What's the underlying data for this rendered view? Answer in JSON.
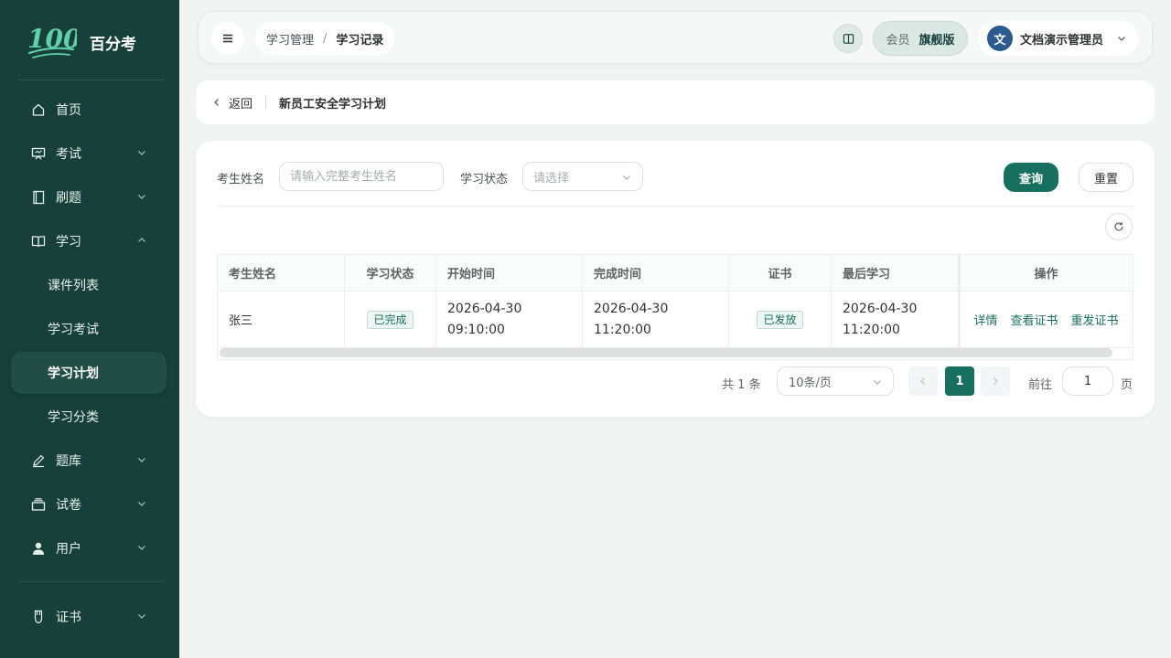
{
  "brand": {
    "logo_text": "100",
    "name": "百分考"
  },
  "sidebar": {
    "items": [
      {
        "label": "首页",
        "icon": "home-icon"
      },
      {
        "label": "考试",
        "icon": "presentation-icon"
      },
      {
        "label": "刷题",
        "icon": "notebook-icon"
      },
      {
        "label": "学习",
        "icon": "open-book-icon"
      },
      {
        "label": "题库",
        "icon": "pen-icon"
      },
      {
        "label": "试卷",
        "icon": "stack-icon"
      },
      {
        "label": "用户",
        "icon": "user-icon"
      },
      {
        "label": "证书",
        "icon": "badge-icon"
      }
    ],
    "sub_items": [
      {
        "label": "课件列表"
      },
      {
        "label": "学习考试"
      },
      {
        "label": "学习计划"
      },
      {
        "label": "学习分类"
      }
    ]
  },
  "header": {
    "breadcrumb": [
      "学习管理",
      "学习记录"
    ],
    "breadcrumb_sep": "/",
    "vip_label": "会员",
    "vip_tier": "旗舰版",
    "avatar_text": "文",
    "user_name": "文档演示管理员"
  },
  "backbar": {
    "back_label": "返回",
    "title": "新员工安全学习计划"
  },
  "filters": {
    "name_label": "考生姓名",
    "name_placeholder": "请输入完整考生姓名",
    "status_label": "学习状态",
    "status_placeholder": "请选择",
    "query_label": "查询",
    "reset_label": "重置"
  },
  "table": {
    "columns": [
      "考生姓名",
      "学习状态",
      "开始时间",
      "完成时间",
      "证书",
      "最后学习",
      "操作"
    ],
    "rows": [
      {
        "name": "张三",
        "status": "已完成",
        "start_date": "2026-04-30",
        "start_time": "09:10:00",
        "finish_date": "2026-04-30",
        "finish_time": "11:20:00",
        "certificate": "已发放",
        "last_date": "2026-04-30",
        "last_time": "11:20:00",
        "actions": [
          "详情",
          "查看证书",
          "重发证书"
        ]
      }
    ]
  },
  "pagination": {
    "total_text": "共 1 条",
    "page_size": "10条/页",
    "current_page": "1",
    "goto_label": "前往",
    "goto_value": "1",
    "page_suffix": "页"
  },
  "colors": {
    "sidebar_bg": "#17403a",
    "primary": "#17705f",
    "page_bg": "#f1f4f3"
  }
}
